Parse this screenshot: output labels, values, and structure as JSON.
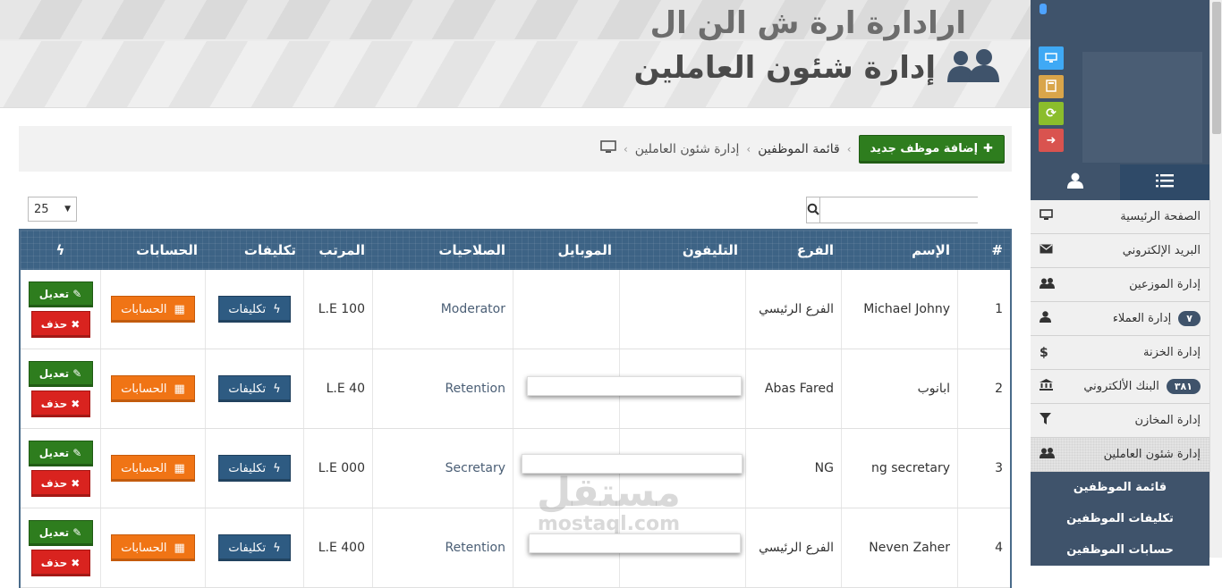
{
  "header": {
    "ghost_title": "ارادارة ارة ش الن ال",
    "title": "إدارة شئون العاملين"
  },
  "breadcrumb": {
    "items": [
      "إدارة شئون العاملين",
      "قائمة الموظفين"
    ],
    "add_button": "إضافة موظف جديد"
  },
  "controls": {
    "page_size": "25",
    "search_placeholder": ""
  },
  "table": {
    "headers": {
      "num": "#",
      "name": "الإسم",
      "branch": "الفرع",
      "phone": "التليفون",
      "mobile": "الموبايل",
      "permissions": "الصلاحيات",
      "salary": "المرتب",
      "costs": "تكليفات",
      "accounts": "الحسابات"
    },
    "cost_button": "تكليفات",
    "accounts_button": "الحسابات",
    "edit_button": "تعديل",
    "delete_button": "حذف",
    "rows": [
      {
        "num": "1",
        "name": "Michael Johny",
        "branch": "الفرع الرئيسي",
        "phone": "",
        "mobile": "",
        "permissions": "Moderator",
        "salary": "L.E 100"
      },
      {
        "num": "2",
        "name": "ابانوب",
        "branch": "Abas Fared",
        "phone": "",
        "mobile": "",
        "permissions": "Retention",
        "salary": "L.E 40"
      },
      {
        "num": "3",
        "name": "ng secretary",
        "branch": "NG",
        "phone": "",
        "mobile": "",
        "permissions": "Secretary",
        "salary": "L.E 000"
      },
      {
        "num": "4",
        "name": "Neven Zaher",
        "branch": "الفرع الرئيسي",
        "phone": "",
        "mobile": "",
        "permissions": "Retention",
        "salary": "L.E 400"
      }
    ]
  },
  "watermark": {
    "arabic": "مستقل",
    "latin": "mostaql.com"
  },
  "sidebar": {
    "menu": [
      {
        "label": "الصفحة الرئيسية",
        "icon": "monitor-icon",
        "badge": ""
      },
      {
        "label": "البريد الإلكتروني",
        "icon": "envelope-icon",
        "badge": ""
      },
      {
        "label": "إدارة الموزعين",
        "icon": "users-icon",
        "badge": ""
      },
      {
        "label": "إدارة العملاء",
        "icon": "user-icon",
        "badge": "٧"
      },
      {
        "label": "إدارة الخزنة",
        "icon": "dollar-icon",
        "badge": ""
      },
      {
        "label": "البنك الألكتروني",
        "icon": "bank-icon",
        "badge": "٣٨١"
      },
      {
        "label": "إدارة المخازن",
        "icon": "filter-icon",
        "badge": ""
      },
      {
        "label": "إدارة شئون العاملين",
        "icon": "users-icon",
        "badge": ""
      }
    ],
    "submenu": [
      "قائمة الموظفين",
      "تكليفات الموظفين",
      "حسابات الموظفين"
    ]
  },
  "colors": {
    "sidebar_dark": "#3f536b",
    "table_header": "#3d6385",
    "green": "#2e7d1e",
    "orange": "#f07415",
    "red": "#d9231f",
    "navy_btn": "#2e5b82"
  }
}
